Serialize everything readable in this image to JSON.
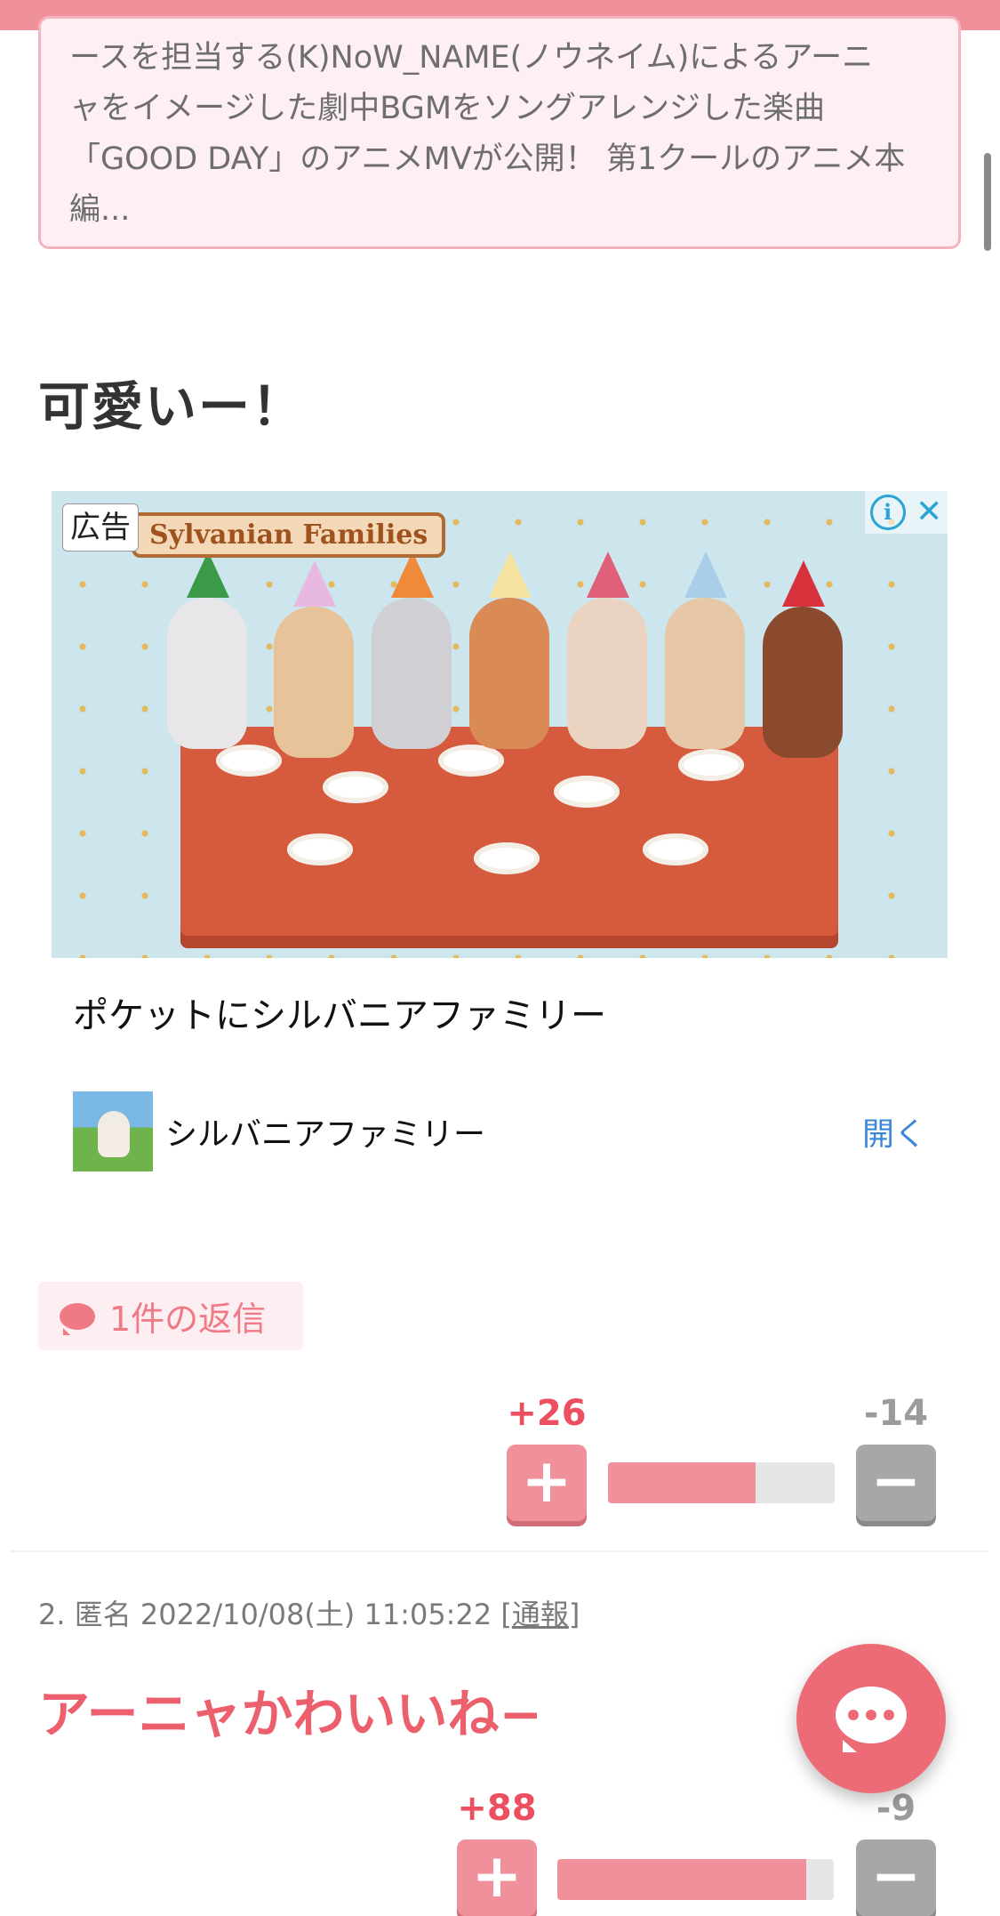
{
  "quote_card": {
    "lines": [
      "ースを担当する(K)NoW_NAME(ノウネイム)によるアーニ",
      "ャをイメージした劇中BGMをソングアレンジした楽曲",
      "「GOOD DAY」のアニメMVが公開！ 第1クールのアニメ本",
      "編..."
    ]
  },
  "comment1": {
    "body": "可愛いー！",
    "reply_badge": "1件の返信",
    "votes": {
      "plus": "+26",
      "minus": "-14",
      "plus_ratio": 0.65
    }
  },
  "ad": {
    "label": "広告",
    "logo_text": "Sylvanian Families",
    "caption": "ポケットにシルバニアファミリー",
    "advertiser": "シルバニアファミリー",
    "open_label": "開く",
    "info_glyph": "i",
    "close_glyph": "✕"
  },
  "comment2": {
    "meta_prefix": "2. 匿名 2022/10/08(土) 11:05:22 [",
    "report_label": "通報",
    "meta_suffix": "]",
    "body": "アーニャかわいいね−",
    "votes": {
      "plus": "+88",
      "minus": "-9",
      "plus_ratio": 0.9
    }
  },
  "buttons": {
    "plus_glyph": "+",
    "minus_glyph": "−"
  },
  "icons": {
    "reply": "speech-bubble-icon",
    "fab": "chat-bubble-icon",
    "ad_info": "info-icon",
    "ad_close": "close-icon"
  },
  "colors": {
    "accent": "#ec6b77",
    "topbar": "#f0909a",
    "quote_bg": "#fdeff2",
    "link": "#3b88d6"
  }
}
